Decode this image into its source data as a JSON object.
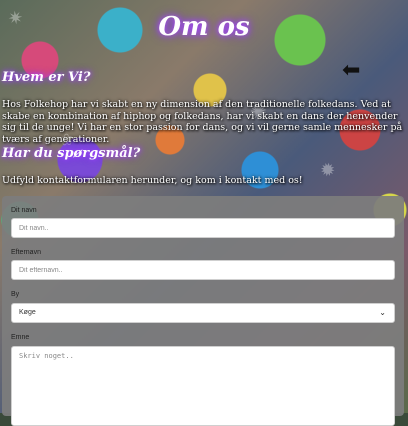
{
  "page": {
    "title": "Om os"
  },
  "sections": {
    "who_heading": "Hvem er Vi?",
    "who_text": "Hos Folkehop har vi skabt en ny dimension af den traditionelle folkedans. Ved at skabe en kombination af hiphop og folkedans, har vi skabt en dans der henvender sig til de unge! Vi har en stor passion for dans, og vi vil gerne samle mennesker på tværs af generationer.",
    "questions_heading": "Har du spørgsmål?",
    "questions_text": "Udfyld kontaktformularen herunder, og kom i kontakt med os!"
  },
  "form": {
    "name_label": "Dit navn",
    "name_placeholder": "Dit navn..",
    "lastname_label": "Efternavn",
    "lastname_placeholder": "Dit efternavn..",
    "city_label": "By",
    "city_selected": "Køge",
    "subject_label": "Emne",
    "subject_placeholder": "Skriv noget.."
  },
  "icons": {
    "arrow": "arrow-left-icon",
    "chevron": "chevron-down-icon"
  },
  "colors": {
    "title_glow": "#b04cff",
    "form_panel": "#7d7d7d"
  }
}
